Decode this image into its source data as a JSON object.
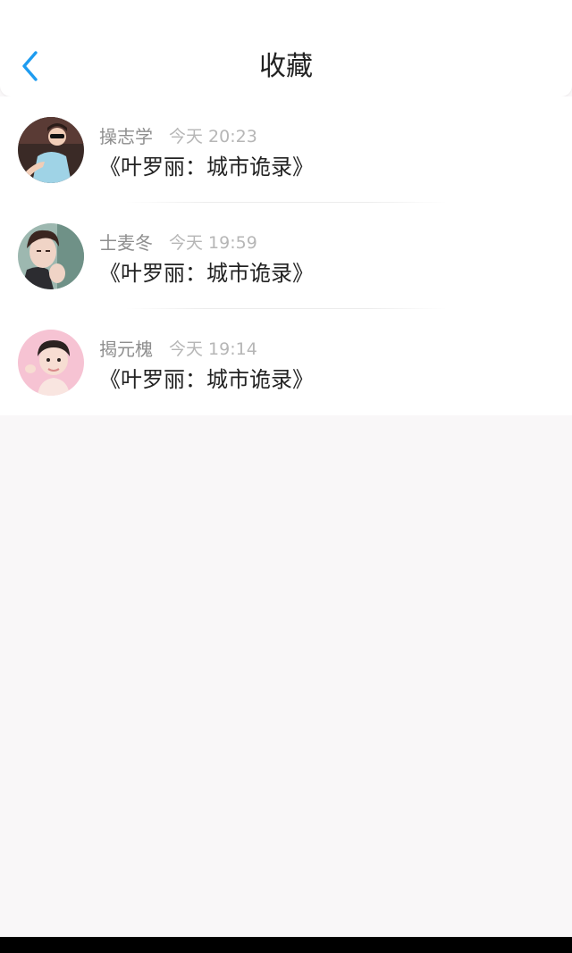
{
  "header": {
    "title": "收藏",
    "back_icon": "chevron-left-icon"
  },
  "colors": {
    "accent": "#1e9cf0",
    "background": "#f9f7f8",
    "name_text": "#8e8e8e",
    "time_text": "#b6b6b6",
    "content_text": "#222222"
  },
  "favorites": [
    {
      "name": "操志学",
      "time": "今天 20:23",
      "content": "《叶罗丽：城市诡录》",
      "avatar": "avatar-boy-sunglasses"
    },
    {
      "name": "士麦冬",
      "time": "今天 19:59",
      "content": "《叶罗丽：城市诡录》",
      "avatar": "avatar-man-portrait"
    },
    {
      "name": "揭元槐",
      "time": "今天 19:14",
      "content": "《叶罗丽：城市诡录》",
      "avatar": "avatar-baby-pink"
    }
  ]
}
